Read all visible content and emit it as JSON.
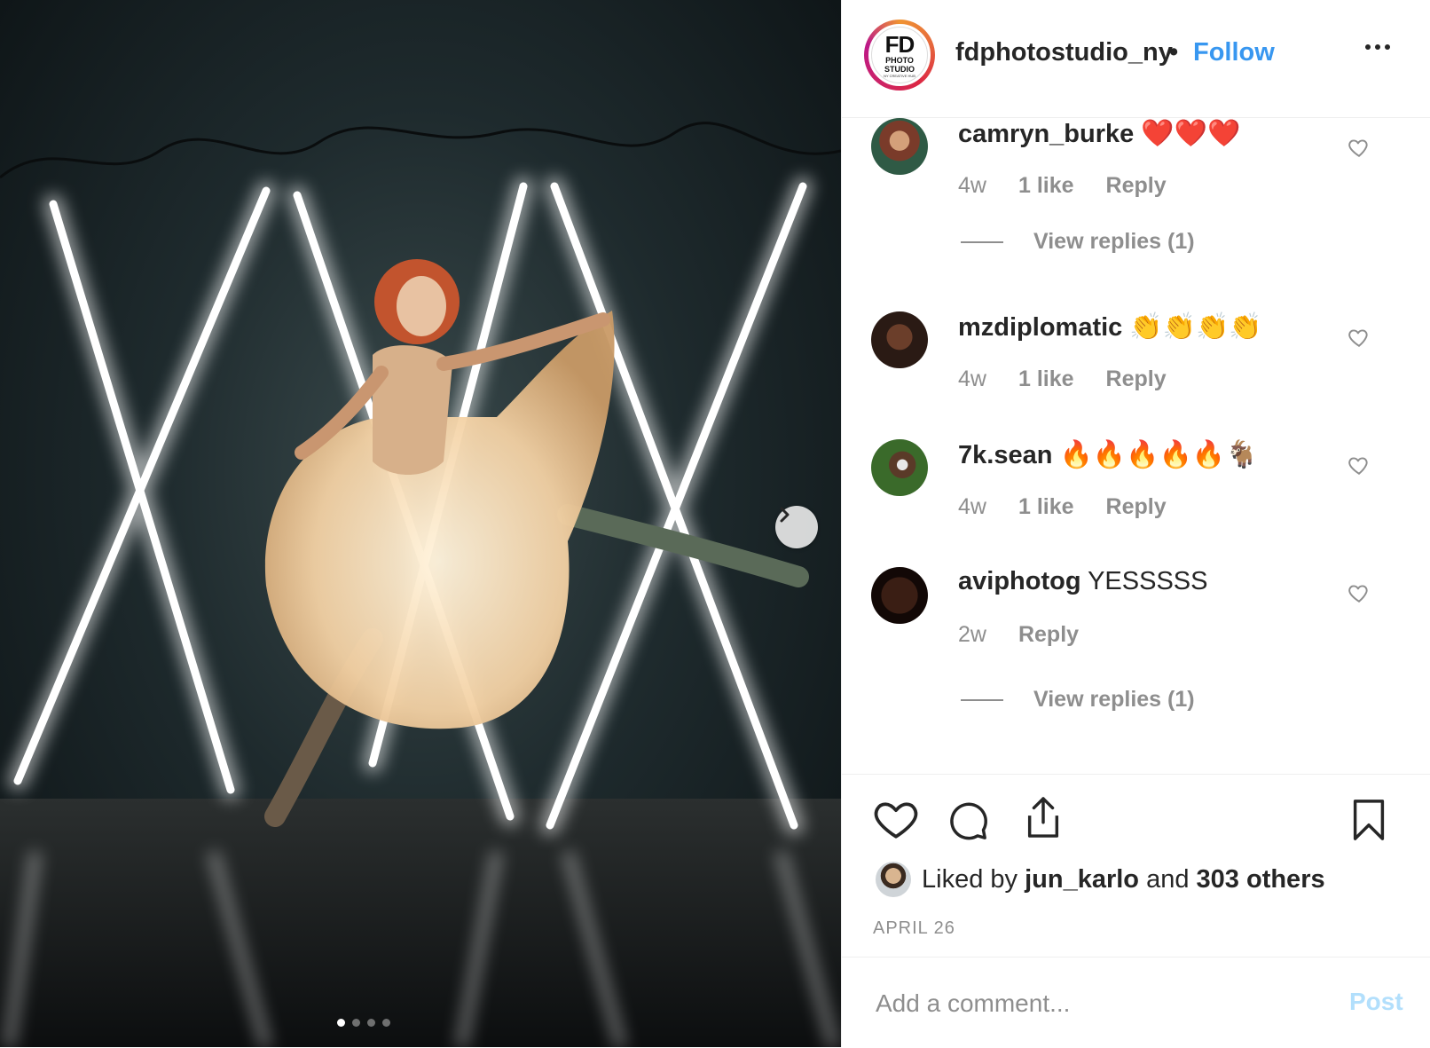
{
  "post": {
    "username": "fdphotostudio_ny",
    "separator": "•",
    "follow_label": "Follow",
    "avatar_logo": {
      "main": "FD",
      "line1": "PHOTO",
      "line2": "STUDIO",
      "tiny": "NY CREATIVE HUB"
    }
  },
  "comments": [
    {
      "user": "camryn_burke",
      "text": "",
      "emoji": "❤️❤️❤️",
      "time": "4w",
      "likes": "1 like",
      "reply": "Reply",
      "view_replies": "View replies (1)"
    },
    {
      "user": "mzdiplomatic",
      "text": "",
      "emoji": "👏👏👏👏",
      "time": "4w",
      "likes": "1 like",
      "reply": "Reply",
      "view_replies": ""
    },
    {
      "user": "7k.sean",
      "text": "",
      "emoji": "🔥🔥🔥🔥🔥🐐",
      "time": "4w",
      "likes": "1 like",
      "reply": "Reply",
      "view_replies": ""
    },
    {
      "user": "aviphotog",
      "text": "YESSSSS",
      "emoji": "",
      "time": "2w",
      "likes": "",
      "reply": "Reply",
      "view_replies": "View replies (1)"
    }
  ],
  "likes": {
    "prefix": "Liked by",
    "user": "jun_karlo",
    "and": "and",
    "others": "303 others"
  },
  "date": "APRIL 26",
  "comment_box": {
    "placeholder": "Add a comment...",
    "post_label": "Post"
  },
  "carousel": {
    "total": 4,
    "active": 1
  },
  "icons": [
    "more-icon",
    "heart-icon",
    "comment-icon",
    "share-icon",
    "bookmark-icon",
    "chevron-right-icon"
  ],
  "colors": {
    "follow": "#3897f0",
    "post_disabled": "#b2dffc",
    "muted": "#8e8e8e",
    "text": "#262626"
  }
}
